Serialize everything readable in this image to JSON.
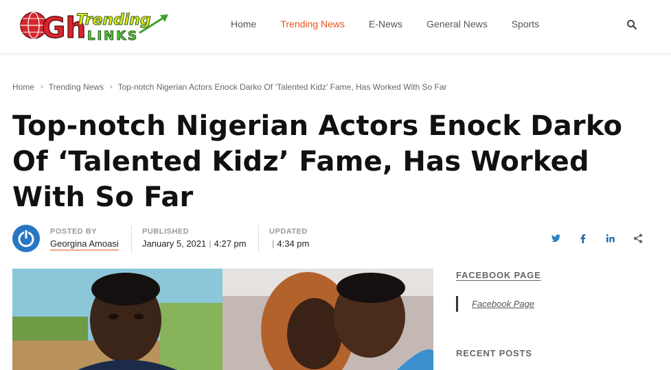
{
  "header": {
    "logo": {
      "main": "Gh",
      "top": "Trending",
      "bottom": "LINKS"
    },
    "nav": [
      "Home",
      "Trending News",
      "E-News",
      "General News",
      "Sports"
    ],
    "active_nav": "Trending News",
    "accent_color": "#e8551c",
    "search_icon": "search-icon"
  },
  "breadcrumb": {
    "items": [
      "Home",
      "Trending News",
      "Top-notch Nigerian Actors Enock Darko Of ‘Talented Kidz’ Fame, Has Worked With So Far"
    ]
  },
  "article": {
    "title": "Top-notch Nigerian Actors Enock Darko Of ‘Talented Kidz’ Fame, Has Worked With So Far",
    "posted_by_label": "POSTED BY",
    "author": "Georgina Amoasi",
    "published_label": "PUBLISHED",
    "published_date": "January 5, 2021",
    "published_time": "4:27 pm",
    "updated_label": "UPDATED",
    "updated_time": "4:34 pm",
    "share_icons": [
      "twitter-icon",
      "facebook-icon",
      "linkedin-icon",
      "share-icon"
    ]
  },
  "sidebar": {
    "facebook_heading": "FACEBOOK PAGE",
    "facebook_link": "Facebook Page",
    "recent_heading": "RECENT POSTS"
  }
}
